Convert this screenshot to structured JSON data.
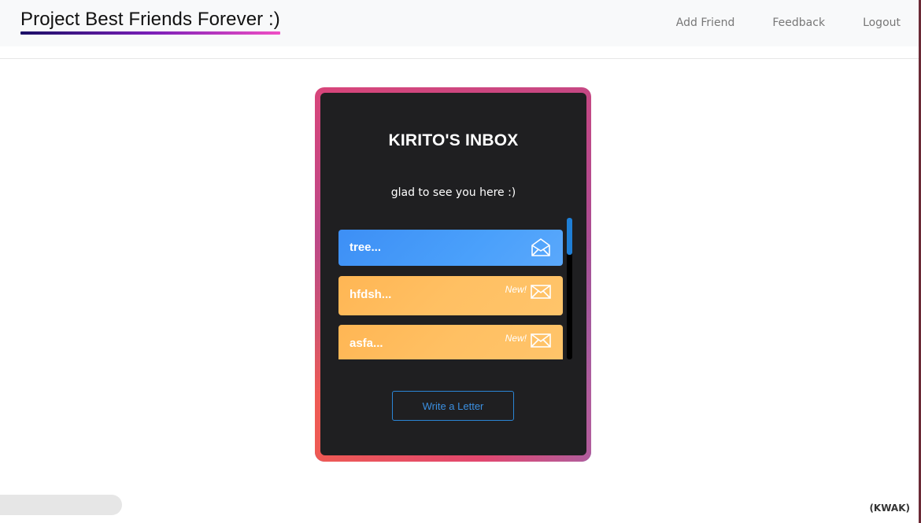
{
  "navbar": {
    "brand": "Project Best Friends Forever :)",
    "links": [
      "Add Friend",
      "Feedback",
      "Logout"
    ]
  },
  "inbox": {
    "title": "KIRITO'S INBOX",
    "subtitle": "glad to see you here :)",
    "letters": [
      {
        "label": "tree...",
        "status": "read",
        "badge": "",
        "icon": "envelope-open-icon"
      },
      {
        "label": "hfdsh...",
        "status": "new",
        "badge": "New!",
        "icon": "envelope-icon"
      },
      {
        "label": "asfa...",
        "status": "new",
        "badge": "New!",
        "icon": "envelope-icon"
      }
    ],
    "write_button": "Write a Letter"
  },
  "footer": {
    "tag": "(KWAK)"
  },
  "colors": {
    "read_letter": "#4a9cfb",
    "new_letter": "#ffbf60",
    "card_bg": "#1f1f21",
    "accent": "#2b86d6"
  }
}
